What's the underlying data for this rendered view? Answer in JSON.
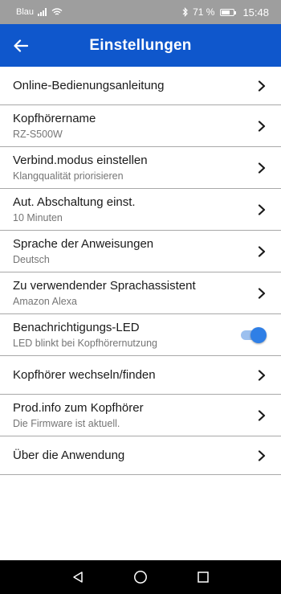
{
  "status_bar": {
    "carrier": "Blau",
    "battery_percent": "71 %",
    "battery_level": 0.71,
    "time": "15:48"
  },
  "app_bar": {
    "title": "Einstellungen",
    "back_icon": "arrow-left-icon",
    "color": "#0f57cc"
  },
  "settings": [
    {
      "title": "Online-Bedienungsanleitung",
      "subtitle": ""
    },
    {
      "title": "Kopfhörername",
      "subtitle": "RZ-S500W"
    },
    {
      "title": "Verbind.modus einstellen",
      "subtitle": "Klangqualität priorisieren"
    },
    {
      "title": "Aut. Abschaltung einst.",
      "subtitle": "10 Minuten"
    },
    {
      "title": "Sprache der Anweisungen",
      "subtitle": "Deutsch"
    },
    {
      "title": "Zu verwendender Sprachassistent",
      "subtitle": "Amazon Alexa"
    },
    {
      "title": "Benachrichtigungs-LED",
      "subtitle": "LED blinkt bei Kopfhörernutzung",
      "toggle_on": true
    },
    {
      "title": "Kopfhörer wechseln/finden",
      "subtitle": ""
    },
    {
      "title": "Prod.info zum Kopfhörer",
      "subtitle": "Die Firmware ist aktuell."
    },
    {
      "title": "Über die Anwendung",
      "subtitle": ""
    }
  ],
  "nav_bar": {
    "back_icon": "triangle-back-icon",
    "home_icon": "circle-home-icon",
    "recents_icon": "square-recents-icon"
  }
}
